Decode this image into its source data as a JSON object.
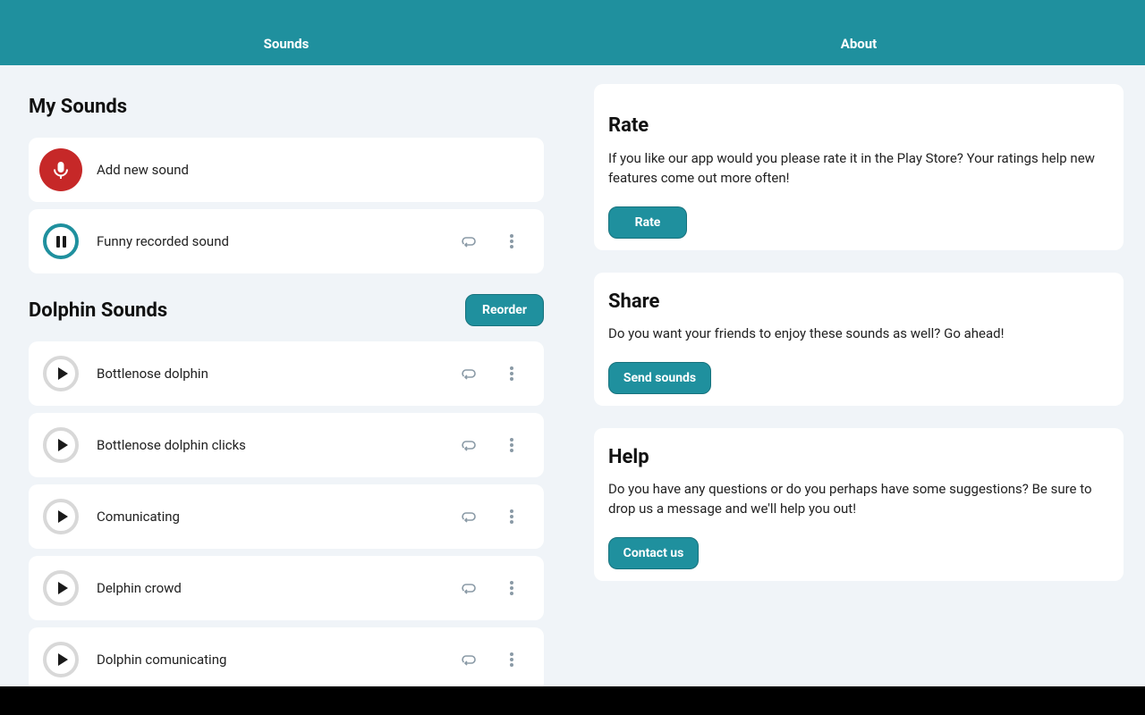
{
  "tabs": {
    "sounds": "Sounds",
    "about": "About"
  },
  "my_sounds": {
    "title": "My Sounds",
    "add_label": "Add new sound",
    "recorded_label": "Funny recorded sound"
  },
  "dolphin": {
    "title": "Dolphin Sounds",
    "reorder_label": "Reorder",
    "items": [
      "Bottlenose dolphin",
      "Bottlenose dolphin clicks",
      "Comunicating",
      "Delphin crowd",
      "Dolphin comunicating"
    ]
  },
  "about": {
    "rate": {
      "title": "Rate",
      "text": "If you like our app would you please rate it in the Play Store? Your ratings help new features come out more often!",
      "button": "Rate"
    },
    "share": {
      "title": "Share",
      "text": "Do you want your friends to enjoy these sounds as well? Go ahead!",
      "button": "Send sounds"
    },
    "help": {
      "title": "Help",
      "text": "Do you have any questions or do you perhaps have some suggestions? Be sure to drop us a message and we'll help you out!",
      "button": "Contact us"
    }
  },
  "colors": {
    "accent": "#1f909e",
    "record": "#c62828",
    "background": "#f0f4f8"
  },
  "icons": [
    "mic-icon",
    "pause-icon",
    "play-icon",
    "loop-icon",
    "more-vert-icon"
  ]
}
